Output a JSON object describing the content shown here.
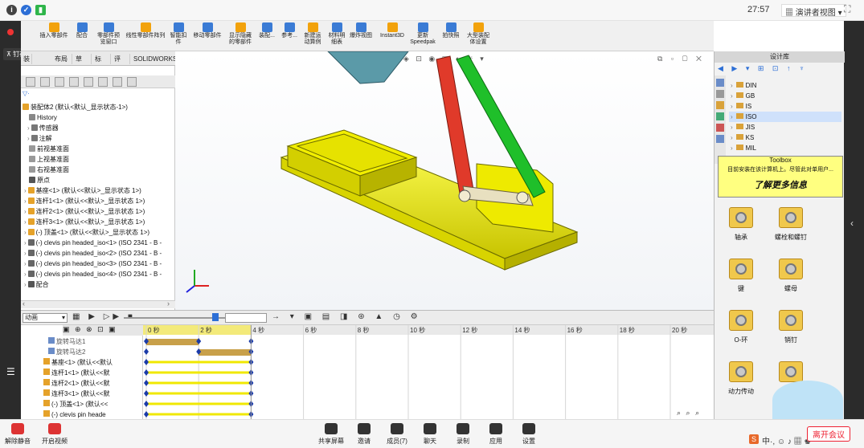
{
  "meeting": {
    "time": "27:57",
    "view_label": "演讲者视图",
    "view_arrow": "▾",
    "pin_label": "钉在画面",
    "bottom_buttons": [
      {
        "label": "解除静音",
        "icon": "microphone-muted-icon"
      },
      {
        "label": "开启视频",
        "icon": "camera-off-icon"
      },
      {
        "label": "共享屏幕",
        "icon": "share-screen-icon"
      },
      {
        "label": "邀请",
        "icon": "invite-icon"
      },
      {
        "label": "成员(7)",
        "icon": "members-icon"
      },
      {
        "label": "聊天",
        "icon": "chat-icon"
      },
      {
        "label": "录制",
        "icon": "record-icon"
      },
      {
        "label": "应用",
        "icon": "apps-icon"
      },
      {
        "label": "设置",
        "icon": "settings-icon"
      }
    ],
    "end_button": "离开会议",
    "ime_text": "中·, ☺ ♪ ▦ ♚"
  },
  "toolbar": {
    "buttons": [
      {
        "label": "插入零部件"
      },
      {
        "label": "配合"
      },
      {
        "label": "零部件预览窗口"
      },
      {
        "label": "线性零部件阵列"
      },
      {
        "label": "智能扣件"
      },
      {
        "label": "移动零部件"
      },
      {
        "label": "显示隐藏的零部件"
      },
      {
        "label": "装配..."
      },
      {
        "label": "参考..."
      },
      {
        "label": "新建运动算例"
      },
      {
        "label": "材料明细表"
      },
      {
        "label": "爆炸视图"
      },
      {
        "label": "Instant3D"
      },
      {
        "label": "更新Speedpak"
      },
      {
        "label": "拍快照"
      },
      {
        "label": "大型装配体设置"
      }
    ],
    "colors": {
      "icon": "#3a7bd5",
      "accent": "#f2a20c"
    }
  },
  "tabs": [
    "布局",
    "草图",
    "标注",
    "评估",
    "SOLIDWORKS 插件",
    "MBD",
    "SOLIDWORKS CAM"
  ],
  "tab_first_partial": "装",
  "feature_tree": {
    "filter_label": "▽·",
    "root": "装配体2 (默认<默认_显示状态-1>)",
    "items": [
      {
        "label": "History",
        "icon": "history-icon",
        "color": "#888"
      },
      {
        "label": "传感器",
        "icon": "sensor-icon",
        "color": "#777"
      },
      {
        "label": "注解",
        "icon": "annotation-icon",
        "color": "#777"
      },
      {
        "label": "前视基准面",
        "icon": "plane-icon",
        "color": "#999"
      },
      {
        "label": "上视基准面",
        "icon": "plane-icon",
        "color": "#999"
      },
      {
        "label": "右视基准面",
        "icon": "plane-icon",
        "color": "#999"
      },
      {
        "label": "原点",
        "icon": "origin-icon",
        "color": "#555"
      },
      {
        "label": "基座<1> (默认<<默认>_显示状态 1>)",
        "icon": "part-icon",
        "color": "#e5a22a"
      },
      {
        "label": "连杆1<1> (默认<<默认>_显示状态 1>)",
        "icon": "part-icon",
        "color": "#e5a22a"
      },
      {
        "label": "连杆2<1> (默认<<默认>_显示状态 1>)",
        "icon": "part-icon",
        "color": "#e5a22a"
      },
      {
        "label": "连杆3<1> (默认<<默认>_显示状态 1>)",
        "icon": "part-icon",
        "color": "#e5a22a"
      },
      {
        "label": "(-) 顶盖<1> (默认<<默认>_显示状态 1>)",
        "icon": "part-icon",
        "color": "#e5a22a"
      },
      {
        "label": "(-) clevis pin headed_iso<1> (ISO 2341 - B -",
        "icon": "pin-icon",
        "color": "#666"
      },
      {
        "label": "(-) clevis pin headed_iso<2> (ISO 2341 - B -",
        "icon": "pin-icon",
        "color": "#666"
      },
      {
        "label": "(-) clevis pin headed_iso<3> (ISO 2341 - B -",
        "icon": "pin-icon",
        "color": "#666"
      },
      {
        "label": "(-) clevis pin headed_iso<4> (ISO 2341 - B -",
        "icon": "pin-icon",
        "color": "#666"
      },
      {
        "label": "配合",
        "icon": "mates-icon",
        "color": "#555"
      }
    ]
  },
  "motion": {
    "study_type": "动画",
    "rows": [
      {
        "label": "旋转马达1"
      },
      {
        "label": "旋转马达2"
      },
      {
        "label": "基座<1> (默认<<默认"
      },
      {
        "label": "连杆1<1> (默认<<默"
      },
      {
        "label": "连杆2<1> (默认<<默"
      },
      {
        "label": "连杆3<1> (默认<<默"
      },
      {
        "label": "(-) 顶盖<1> (默认<<"
      },
      {
        "label": "(-) clevis pin heade"
      }
    ],
    "time_marks": [
      "0 秒",
      "2 秒",
      "4 秒",
      "6 秒",
      "8 秒",
      "10 秒",
      "12 秒",
      "14 秒",
      "16 秒",
      "18 秒",
      "20 秒"
    ],
    "motor_bars": [
      {
        "start": 0,
        "end": 2
      },
      {
        "start": 2,
        "end": 4
      }
    ],
    "playhead_sec": 4,
    "keyframes": [
      0,
      2,
      4
    ],
    "colors": {
      "motor": "#c8a04a",
      "component": "#f0e800",
      "key": "#1b3ba8",
      "ruler": "#f3ea7a"
    }
  },
  "design_library": {
    "title": "设计库",
    "items": [
      "DIN",
      "GB",
      "IS",
      "ISO",
      "JIS",
      "KS",
      "MIL"
    ],
    "selected": "ISO",
    "toolbox_title": "Toolbox",
    "toolbox_text": "目前安装在该计算机上。尽管此对单用户...",
    "toolbox_link": "了解更多信息",
    "tiles": [
      {
        "label": "轴承"
      },
      {
        "label": "螺栓和螺钉"
      },
      {
        "label": "键"
      },
      {
        "label": "螺母"
      },
      {
        "label": "O-环"
      },
      {
        "label": "销钉"
      },
      {
        "label": "动力传动"
      },
      {
        "label": ""
      }
    ]
  },
  "model_colors": {
    "base": "#f6f600",
    "link_red": "#e03a2a",
    "link_green": "#1fbf2a",
    "link_teal": "#5b9aa8",
    "pin": "#e8e0c0"
  }
}
